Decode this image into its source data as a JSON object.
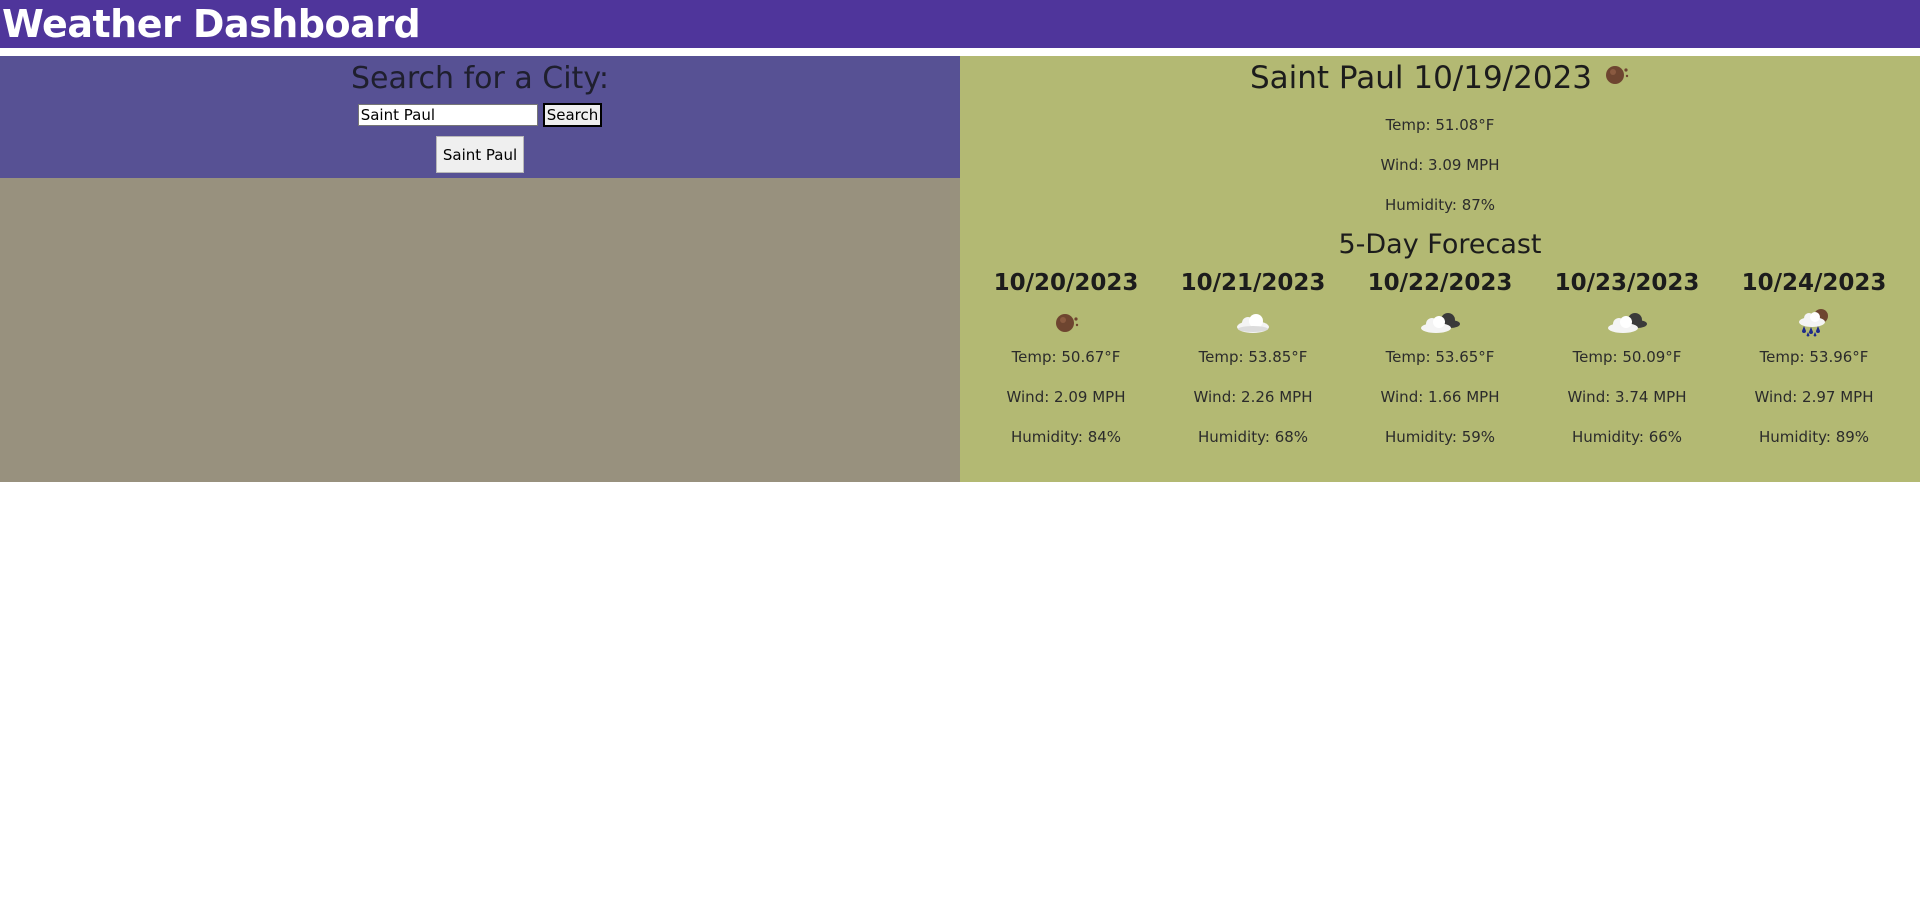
{
  "header": {
    "title": "Weather Dashboard"
  },
  "search": {
    "heading": "Search for a City:",
    "input_value": "Saint Paul",
    "button_label": "Search",
    "history": [
      "Saint Paul"
    ]
  },
  "current": {
    "title": "Saint Paul 10/19/2023",
    "icon": "cloudy-moon-icon",
    "temp": "Temp: 51.08°F",
    "wind": "Wind: 3.09 MPH",
    "humidity": "Humidity: 87%"
  },
  "forecast": {
    "heading": "5-Day Forecast",
    "days": [
      {
        "date": "10/20/2023",
        "icon": "moon-icon",
        "temp": "Temp: 50.67°F",
        "wind": "Wind: 2.09 MPH",
        "humidity": "Humidity: 84%"
      },
      {
        "date": "10/21/2023",
        "icon": "cloud-icon",
        "temp": "Temp: 53.85°F",
        "wind": "Wind: 2.26 MPH",
        "humidity": "Humidity: 68%"
      },
      {
        "date": "10/22/2023",
        "icon": "broken-clouds-icon",
        "temp": "Temp: 53.65°F",
        "wind": "Wind: 1.66 MPH",
        "humidity": "Humidity: 59%"
      },
      {
        "date": "10/23/2023",
        "icon": "broken-clouds-icon",
        "temp": "Temp: 50.09°F",
        "wind": "Wind: 3.74 MPH",
        "humidity": "Humidity: 66%"
      },
      {
        "date": "10/24/2023",
        "icon": "rain-night-icon",
        "temp": "Temp: 53.96°F",
        "wind": "Wind: 2.97 MPH",
        "humidity": "Humidity: 89%"
      }
    ]
  },
  "colors": {
    "header_bg": "#4f359b",
    "search_panel_bg": "#575194",
    "left_fill_bg": "#98917e",
    "forecast_bg": "#b3b973"
  }
}
